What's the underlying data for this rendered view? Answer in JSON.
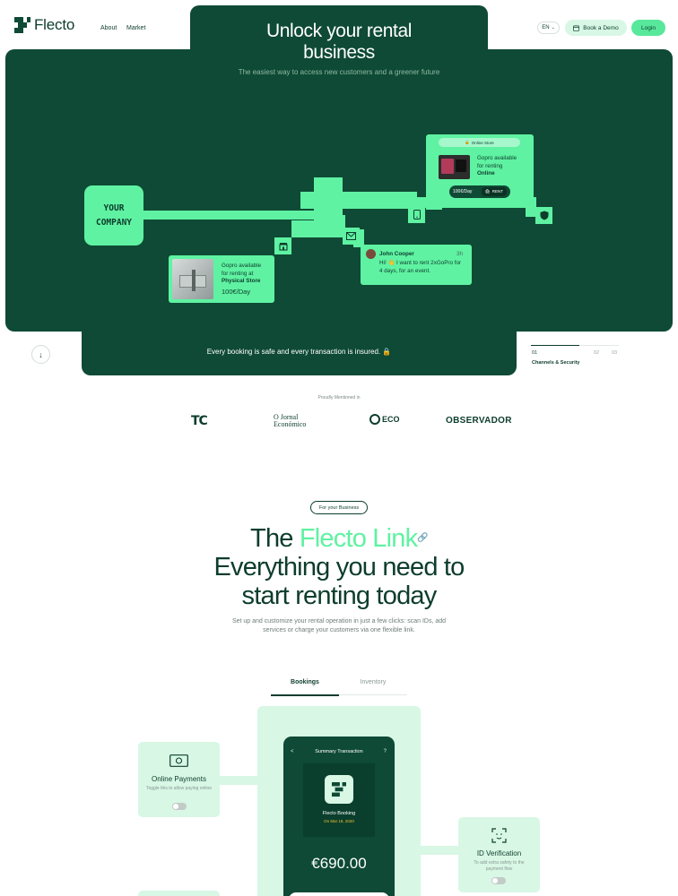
{
  "brand": {
    "logo_text": "Flecto",
    "accent": "#5ff2a2",
    "dark": "#0e4a35"
  },
  "nav": {
    "about": "About",
    "market": "Market"
  },
  "header_actions": {
    "lang": "EN",
    "demo": "Book a Demo",
    "login": "Login"
  },
  "hero": {
    "title_line1": "Unlock your rental",
    "title_line2": "business",
    "subtitle": "The easiest way to access new customers and a greener future"
  },
  "diagram": {
    "company_line1": "YOUR",
    "company_line2": "COMPANY",
    "online_header": "Online Store",
    "online_text1": "Gopro available",
    "online_text2": "for renting",
    "online_text3": "Online",
    "online_price": "100€/Day",
    "online_button": "RENT",
    "store_text1": "Gopro available",
    "store_text2": "for renting at",
    "store_text3": "Physical Store",
    "store_price": "100€/Day",
    "chat_name": "John Cooper",
    "chat_time": "3h",
    "chat_msg1": "Hi! 👋 I want to rent 2xGoPro for",
    "chat_msg2": "4 days, for an event."
  },
  "hero_footer": {
    "message": "Every booking is safe and every transaction is insured. 🔒",
    "steps": [
      {
        "num": "01",
        "label": "Channels & Security"
      },
      {
        "num": "02",
        "label": ""
      },
      {
        "num": "03",
        "label": ""
      }
    ]
  },
  "press": {
    "heading": "Proudly Mentioned in",
    "tc": "TC",
    "jornal1": "O Jornal",
    "jornal2": "Económico",
    "eco": "ECO",
    "observador": "OBSERVADOR"
  },
  "business": {
    "pill": "For your Business",
    "title_the": "The ",
    "title_accent": "Flecto Link",
    "title_line2": "Everything you need to",
    "title_line3": "start renting today",
    "intro": "Set up and customize your rental operation in just a few clicks: scan IDs, add services or charge your customers via one flexible link."
  },
  "tabs": {
    "bookings": "Bookings",
    "inventory": "Inventory"
  },
  "phone": {
    "header": "Summary Transaction",
    "back": "<",
    "help": "?",
    "booking_title": "Flecto Booking",
    "booking_date": "On Mar 18, 2020",
    "amount": "€690.00"
  },
  "features": {
    "payments_title": "Online Payments",
    "payments_desc": "Toggle this to allow paying online",
    "id_title": "ID Verification",
    "id_desc": "To add extra safety to the payment flow"
  }
}
